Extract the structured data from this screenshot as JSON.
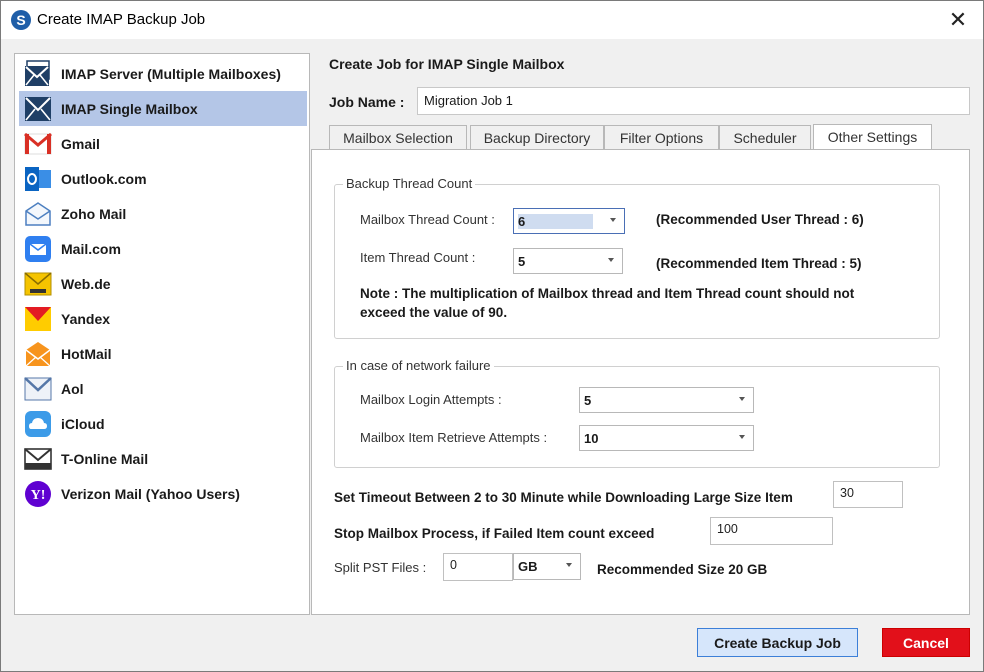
{
  "window": {
    "title": "Create IMAP Backup Job",
    "logo_letter": "S"
  },
  "sidebar": {
    "items": [
      {
        "label": "IMAP Server (Multiple Mailboxes)",
        "icon": "imap-server-icon"
      },
      {
        "label": "IMAP Single Mailbox",
        "icon": "imap-single-icon",
        "selected": true
      },
      {
        "label": "Gmail",
        "icon": "gmail-icon"
      },
      {
        "label": "Outlook.com",
        "icon": "outlook-icon"
      },
      {
        "label": "Zoho Mail",
        "icon": "zoho-mail-icon"
      },
      {
        "label": "Mail.com",
        "icon": "mail-com-icon"
      },
      {
        "label": "Web.de",
        "icon": "web-de-icon"
      },
      {
        "label": "Yandex",
        "icon": "yandex-icon"
      },
      {
        "label": "HotMail",
        "icon": "hotmail-icon"
      },
      {
        "label": "Aol",
        "icon": "aol-icon"
      },
      {
        "label": "iCloud",
        "icon": "icloud-icon"
      },
      {
        "label": "T-Online Mail",
        "icon": "t-online-icon"
      },
      {
        "label": "Verizon Mail (Yahoo Users)",
        "icon": "yahoo-icon"
      }
    ]
  },
  "main": {
    "title": "Create Job for IMAP Single Mailbox",
    "job_name_label": "Job Name :",
    "job_name_value": "Migration Job 1",
    "tabs": [
      {
        "label": "Mailbox Selection"
      },
      {
        "label": "Backup Directory"
      },
      {
        "label": "Filter Options"
      },
      {
        "label": "Scheduler"
      },
      {
        "label": "Other Settings",
        "active": true
      }
    ]
  },
  "thread_group": {
    "legend": "Backup Thread Count",
    "mailbox_thread_label": "Mailbox Thread Count :",
    "mailbox_thread_value": "6",
    "mailbox_thread_reco": "(Recommended User Thread : 6)",
    "item_thread_label": "Item Thread Count :",
    "item_thread_value": "5",
    "item_thread_reco": "(Recommended Item Thread : 5)",
    "note_line1": "Note : The multiplication of Mailbox thread  and Item Thread count should not",
    "note_line2": "exceed the value of 90."
  },
  "network_group": {
    "legend": "In case of network failure",
    "login_attempts_label": "Mailbox Login Attempts :",
    "login_attempts_value": "5",
    "retrieve_attempts_label": "Mailbox Item Retrieve Attempts :",
    "retrieve_attempts_value": "10"
  },
  "settings": {
    "timeout_label": "Set Timeout Between 2 to 30 Minute while Downloading Large Size Item",
    "timeout_value": "30",
    "stop_label": "Stop Mailbox Process, if Failed Item count exceed",
    "stop_value": "100",
    "split_label": "Split PST Files :",
    "split_value": "0",
    "split_unit": "GB",
    "split_reco": "Recommended Size 20 GB"
  },
  "buttons": {
    "create": "Create Backup Job",
    "cancel": "Cancel"
  },
  "colors": {
    "selected_bg": "#b4c6e7",
    "primary_btn": "#d6e6fb",
    "cancel_btn": "#e2101a"
  }
}
